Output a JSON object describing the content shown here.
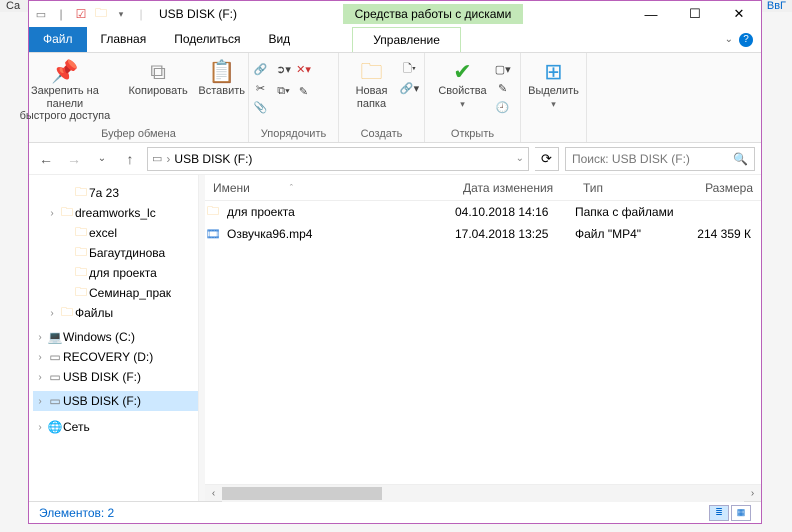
{
  "bg": {
    "right": "ВвГ"
  },
  "title": "USB DISK (F:)",
  "contextualTab": "Средства работы с дисками",
  "tabs": {
    "file": "Файл",
    "home": "Главная",
    "share": "Поделиться",
    "view": "Вид",
    "manage": "Управление"
  },
  "ribbon": {
    "pin": "Закрепить на панели\nбыстрого доступа",
    "copy": "Копировать",
    "paste": "Вставить",
    "gClipboard": "Буфер обмена",
    "gOrganize": "Упорядочить",
    "newFolder": "Новая\nпапка",
    "gCreate": "Создать",
    "props": "Свойства",
    "gOpen": "Открыть",
    "select": "Выделить"
  },
  "address": "USB DISK (F:)",
  "searchPlaceholder": "Поиск: USB DISK (F:)",
  "tree": [
    "7а 23",
    "dreamworks_lc",
    "excel",
    "Багаутдинова",
    "для проекта",
    "Семинар_прак",
    "Файлы",
    "Windows (C:)",
    "RECOVERY (D:)",
    "USB DISK (F:)",
    "USB DISK (F:)",
    "Сеть"
  ],
  "cols": {
    "name": "Имени",
    "date": "Дата изменения",
    "type": "Тип",
    "size": "Размера"
  },
  "files": [
    {
      "name": "для проекта",
      "date": "04.10.2018 14:16",
      "type": "Папка с файлами",
      "size": ""
    },
    {
      "name": "Озвучка96.mp4",
      "date": "17.04.2018 13:25",
      "type": "Файл \"MP4\"",
      "size": "214 359 К"
    }
  ],
  "status": "Элементов: 2"
}
